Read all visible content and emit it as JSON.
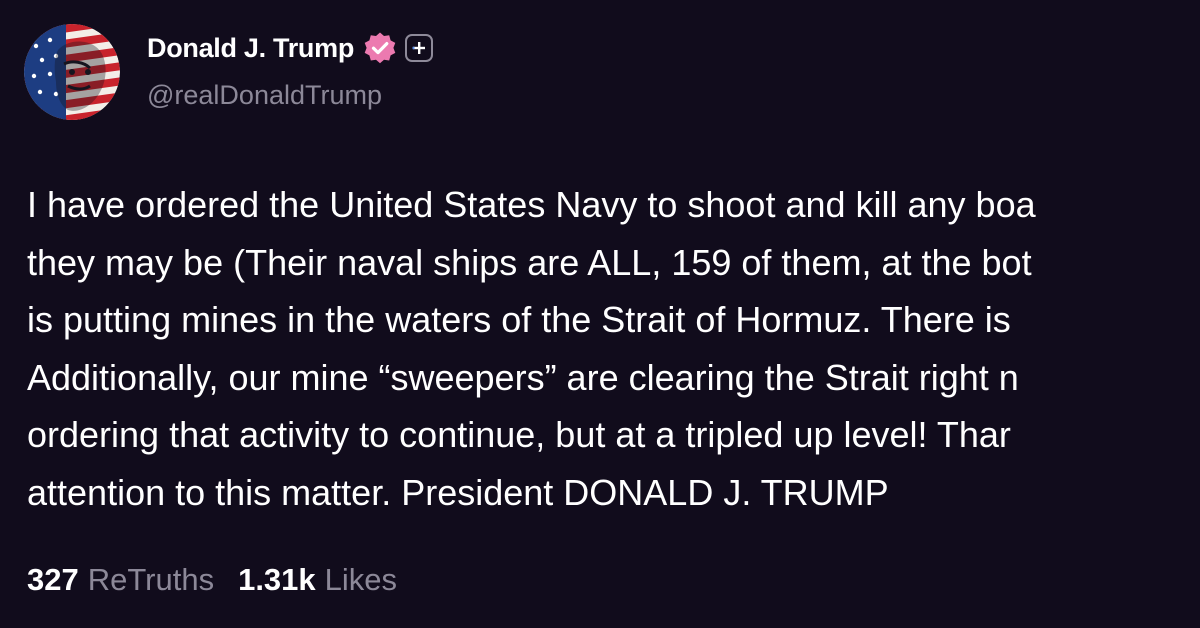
{
  "post": {
    "author": {
      "display_name": "Donald J. Trump",
      "handle": "@realDonaldTrump",
      "avatar_icon": "flag-portrait-avatar",
      "verified_icon": "verified-badge-icon",
      "verified_color": "#ec7ab0",
      "plus_icon": "plus-badge-icon"
    },
    "lines": [
      "I have ordered the United States Navy to shoot and kill any boa",
      "they may be (Their naval ships are ALL, 159 of them, at the bot",
      "is putting mines in the waters of the Strait of Hormuz. There is",
      "Additionally, our mine “sweepers” are clearing the Strait right n",
      "ordering that activity to continue, but at a tripled up level! Thar",
      "attention to this matter. President DONALD J. TRUMP"
    ],
    "stats": {
      "retruths_count": "327",
      "retruths_label": "ReTruths",
      "likes_count": "1.31k",
      "likes_label": "Likes"
    }
  },
  "colors": {
    "background": "#110c1c",
    "text": "#ffffff",
    "muted": "#8c8898"
  }
}
